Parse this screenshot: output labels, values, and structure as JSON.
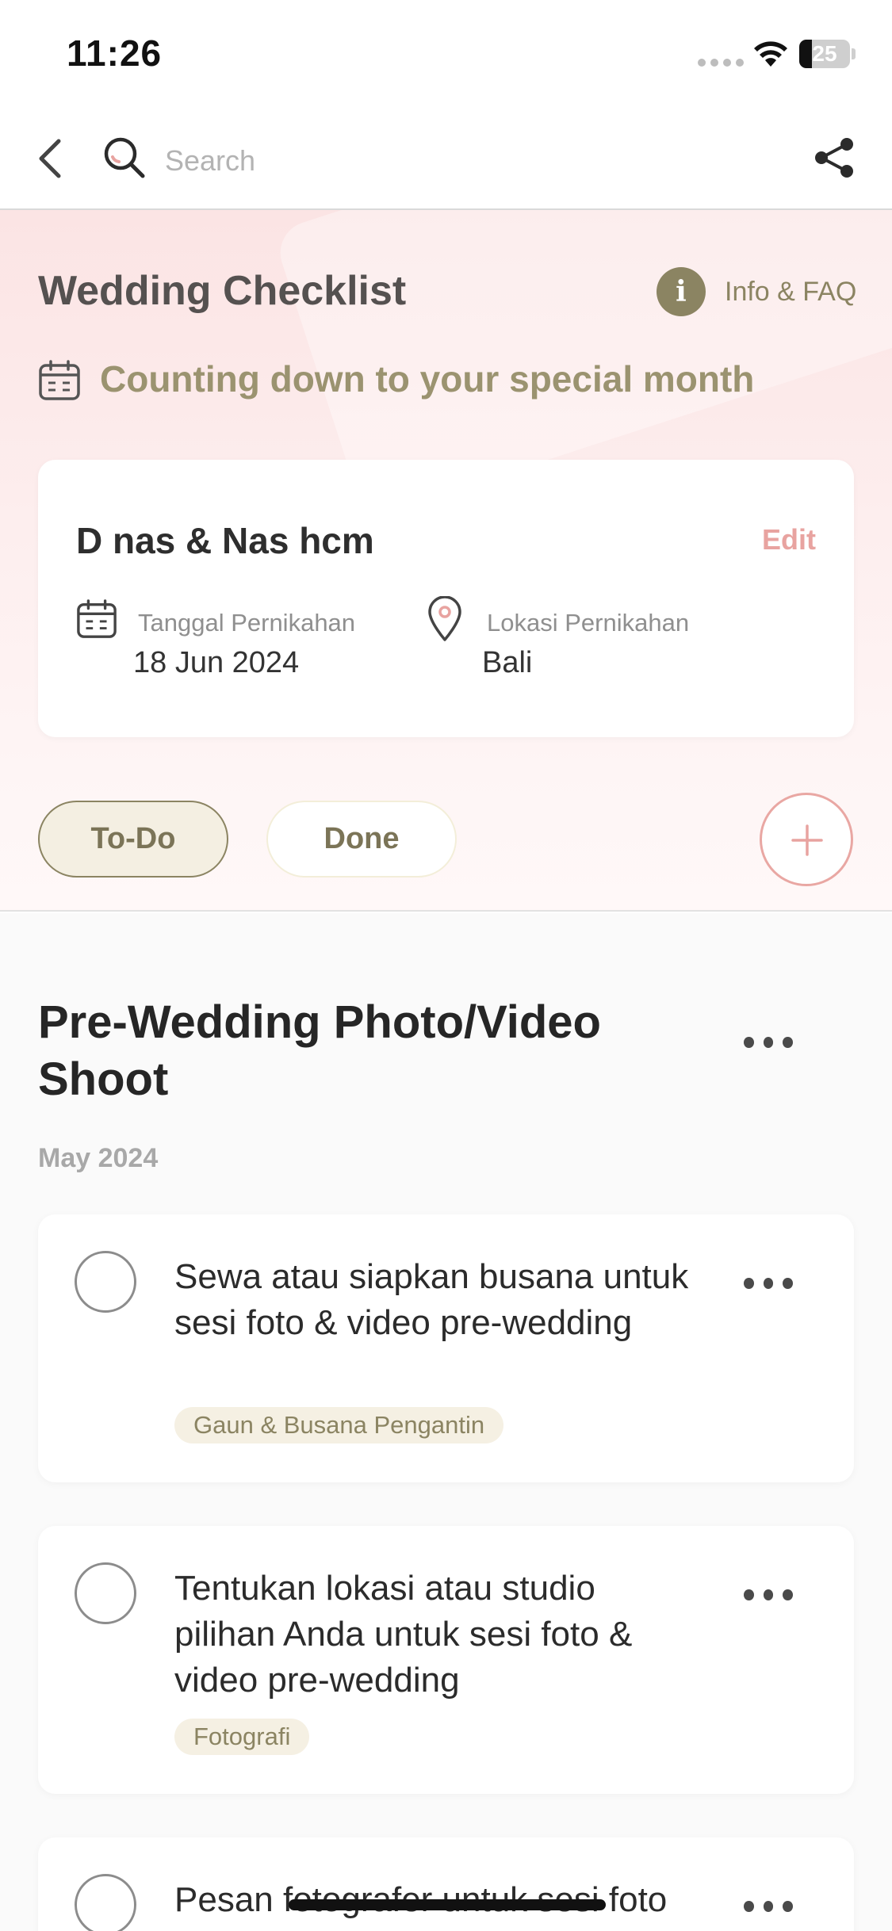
{
  "status_bar": {
    "time": "11:26",
    "battery": "25",
    "battery_level": 0.25
  },
  "nav": {
    "search_placeholder": "Search"
  },
  "header": {
    "title": "Wedding Checklist",
    "info_label": "Info & FAQ",
    "countdown": "Counting down to your special month"
  },
  "wedding": {
    "couple": "D nas & Nas hcm",
    "edit_label": "Edit",
    "date_label": "Tanggal Pernikahan",
    "date_value": "18 Jun 2024",
    "location_label": "Lokasi Pernikahan",
    "location_value": "Bali"
  },
  "tabs": [
    {
      "label": "To-Do",
      "active": true
    },
    {
      "label": "Done",
      "active": false
    }
  ],
  "section": {
    "title": "Pre-Wedding Photo/Video Shoot",
    "month": "May 2024",
    "tasks": [
      {
        "text": "Sewa atau siapkan busana untuk sesi foto & video pre-wedding",
        "tag": "Gaun & Busana Pengantin"
      },
      {
        "text": "Tentukan lokasi atau studio pilihan Anda untuk sesi foto & video pre-wedding",
        "tag": "Fotografi"
      },
      {
        "text": "Pesan fotografer untuk sesi foto",
        "tag": ""
      }
    ]
  },
  "colors": {
    "accent": "#8b8462",
    "pink": "#e8a3a0",
    "hero_bg": "#fbe4e4"
  }
}
